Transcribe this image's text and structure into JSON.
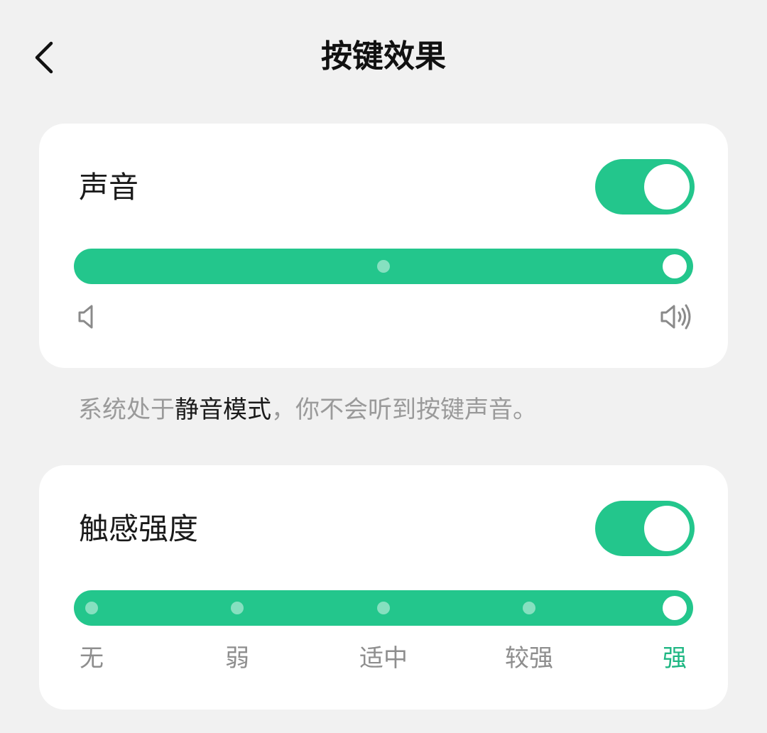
{
  "header": {
    "title": "按键效果",
    "back_icon": "chevron-left-icon"
  },
  "sound": {
    "title": "声音",
    "toggle_on": true,
    "slider_value": 1.0,
    "min_icon": "volume-low-icon",
    "max_icon": "volume-high-icon"
  },
  "note": {
    "prefix": "系统处于",
    "highlight": "静音模式",
    "suffix": "，你不会听到按键声音。"
  },
  "haptic": {
    "title": "触感强度",
    "toggle_on": true,
    "levels": [
      "无",
      "弱",
      "适中",
      "较强",
      "强"
    ],
    "selected_level": "强"
  },
  "colors": {
    "accent": "#23c68c",
    "background": "#f1f1f1",
    "card": "#ffffff",
    "muted_text": "#9a9a9a"
  }
}
